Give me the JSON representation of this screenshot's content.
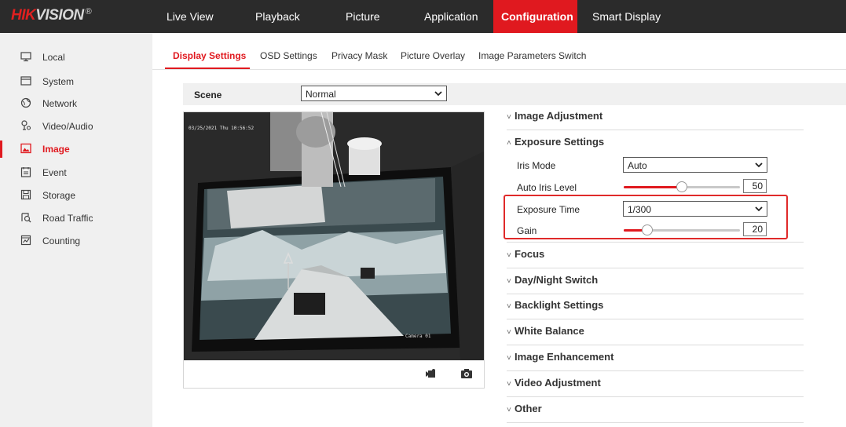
{
  "brand": {
    "logo_red": "HIK",
    "logo_white": "VISION",
    "logo_mark": "®"
  },
  "top_nav": [
    {
      "label": "Live View"
    },
    {
      "label": "Playback"
    },
    {
      "label": "Picture"
    },
    {
      "label": "Application"
    },
    {
      "label": "Configuration",
      "active": true
    },
    {
      "label": "Smart Display"
    }
  ],
  "sidebar": {
    "items": [
      {
        "label": "Local",
        "icon": "monitor-icon"
      },
      {
        "label": "System",
        "icon": "system-icon"
      },
      {
        "label": "Network",
        "icon": "globe-icon"
      },
      {
        "label": "Video/Audio",
        "icon": "video-audio-icon"
      },
      {
        "label": "Image",
        "icon": "image-icon",
        "active": true
      },
      {
        "label": "Event",
        "icon": "event-icon"
      },
      {
        "label": "Storage",
        "icon": "storage-icon"
      },
      {
        "label": "Road Traffic",
        "icon": "road-traffic-icon"
      },
      {
        "label": "Counting",
        "icon": "counting-icon"
      }
    ]
  },
  "sub_tabs": [
    {
      "label": "Display Settings",
      "active": true
    },
    {
      "label": "OSD Settings"
    },
    {
      "label": "Privacy Mask"
    },
    {
      "label": "Picture Overlay"
    },
    {
      "label": "Image Parameters Switch"
    }
  ],
  "scene": {
    "label": "Scene",
    "value": "Normal"
  },
  "video": {
    "timestamp": "03/25/2021 Thu 10:56:52",
    "camera_caption": "Camera 01",
    "controls": [
      "record-icon",
      "snapshot-icon"
    ]
  },
  "sections": {
    "image_adjustment": "Image Adjustment",
    "exposure_settings": "Exposure Settings",
    "focus": "Focus",
    "day_night": "Day/Night Switch",
    "backlight": "Backlight Settings",
    "white_balance": "White Balance",
    "image_enhancement": "Image Enhancement",
    "video_adjustment": "Video Adjustment",
    "other": "Other"
  },
  "exposure": {
    "iris_mode_label": "Iris Mode",
    "iris_mode_value": "Auto",
    "auto_iris_label": "Auto Iris Level",
    "auto_iris_value": "50",
    "auto_iris_fraction": 0.5,
    "exposure_time_label": "Exposure Time",
    "exposure_time_value": "1/300",
    "gain_label": "Gain",
    "gain_value": "20",
    "gain_fraction": 0.2
  },
  "colors": {
    "accent": "#e0191f",
    "topbar": "#2b2b2b",
    "sidebar": "#f0f0f0",
    "highlight": "#e02a2a"
  }
}
